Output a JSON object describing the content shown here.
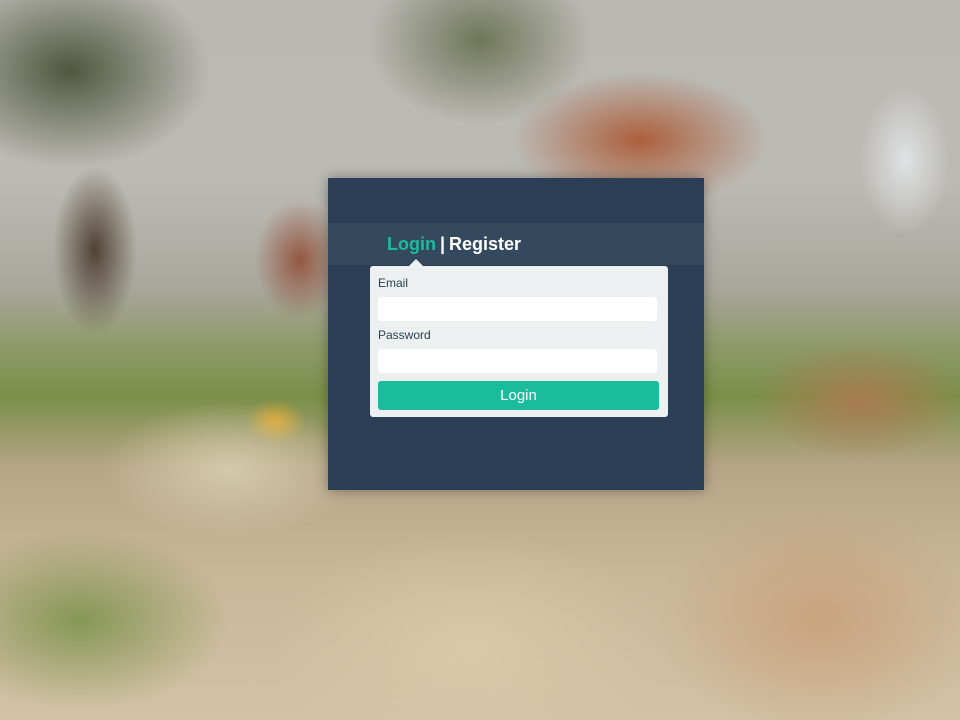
{
  "background": {
    "description_icon": "blurred-autumn-leaves-photo"
  },
  "colors": {
    "modal_bg": "#2c3e55",
    "tabbar_bg": "#34495e",
    "accent": "#1abc9c",
    "panel_bg": "#ecf0f1"
  },
  "tabs": {
    "login_label": "Login",
    "separator": "|",
    "register_label": "Register",
    "active": "Login"
  },
  "form": {
    "email_label": "Email",
    "email_value": "",
    "email_placeholder": "",
    "password_label": "Password",
    "password_value": "",
    "password_placeholder": "",
    "submit_label": "Login"
  }
}
